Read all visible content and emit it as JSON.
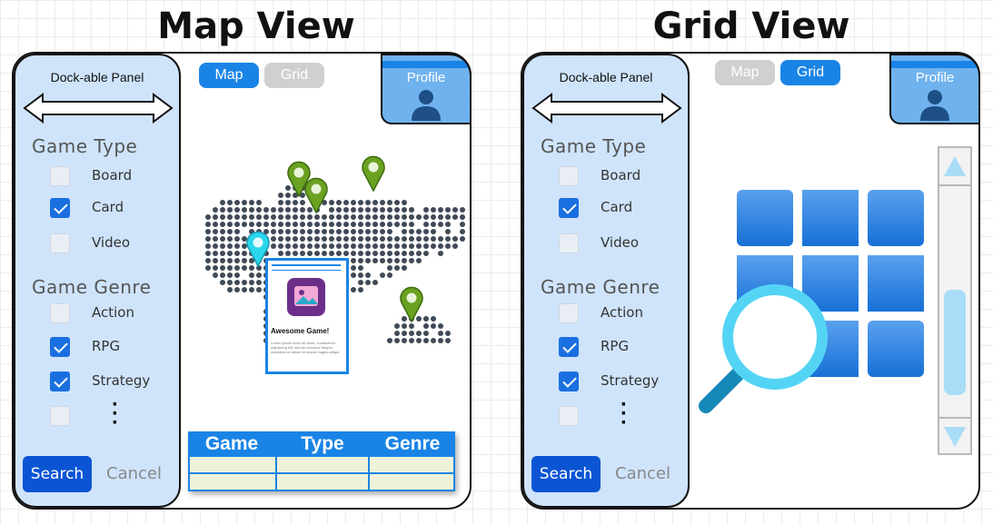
{
  "map_view": {
    "title": "Map View",
    "panel": {
      "title": "Dock-able Panel",
      "game_type": {
        "label": "Game Type",
        "options": [
          {
            "label": "Board",
            "checked": false
          },
          {
            "label": "Card",
            "checked": true
          },
          {
            "label": "Video",
            "checked": false
          }
        ]
      },
      "game_genre": {
        "label": "Game Genre",
        "options": [
          {
            "label": "Action",
            "checked": false
          },
          {
            "label": "RPG",
            "checked": true
          },
          {
            "label": "Strategy",
            "checked": true
          },
          {
            "label": "",
            "checked": false
          }
        ]
      },
      "more_indicator": "⋮",
      "search_label": "Search",
      "cancel_label": "Cancel"
    },
    "tabs": [
      {
        "label": "Map",
        "active": true
      },
      {
        "label": "Grid",
        "active": false
      }
    ],
    "profile_label": "Profile",
    "popup": {
      "title": "Awesome Game!",
      "text": "Lorem ipsum dolor sit amet, consectetur adipiscing elit, sed do eiusmod tempor incididunt ut labore et dolore magna aliqua"
    },
    "results_table": {
      "columns": [
        "Game",
        "Type",
        "Genre"
      ],
      "rows": [
        [
          "",
          "",
          ""
        ],
        [
          "",
          "",
          ""
        ]
      ]
    }
  },
  "grid_view": {
    "title": "Grid View",
    "panel": {
      "title": "Dock-able Panel",
      "game_type": {
        "label": "Game Type",
        "options": [
          {
            "label": "Board",
            "checked": false
          },
          {
            "label": "Card",
            "checked": true
          },
          {
            "label": "Video",
            "checked": false
          }
        ]
      },
      "game_genre": {
        "label": "Game Genre",
        "options": [
          {
            "label": "Action",
            "checked": false
          },
          {
            "label": "RPG",
            "checked": true
          },
          {
            "label": "Strategy",
            "checked": true
          },
          {
            "label": "",
            "checked": false
          }
        ]
      },
      "more_indicator": "⋮",
      "search_label": "Search",
      "cancel_label": "Cancel"
    },
    "tabs": [
      {
        "label": "Map",
        "active": false
      },
      {
        "label": "Grid",
        "active": true
      }
    ],
    "profile_label": "Profile",
    "icons": [
      "grid-search-icon",
      "scroll-up-icon",
      "scroll-down-icon"
    ]
  },
  "colors": {
    "accent": "#1a84e6",
    "panel_bg": "#cfe4fb",
    "search_button": "#0b55d4",
    "pin_green": "#6aa121",
    "pin_cyan": "#2ad6ee",
    "map_dots": "#3f4a56",
    "table_row": "#eef2d9"
  }
}
